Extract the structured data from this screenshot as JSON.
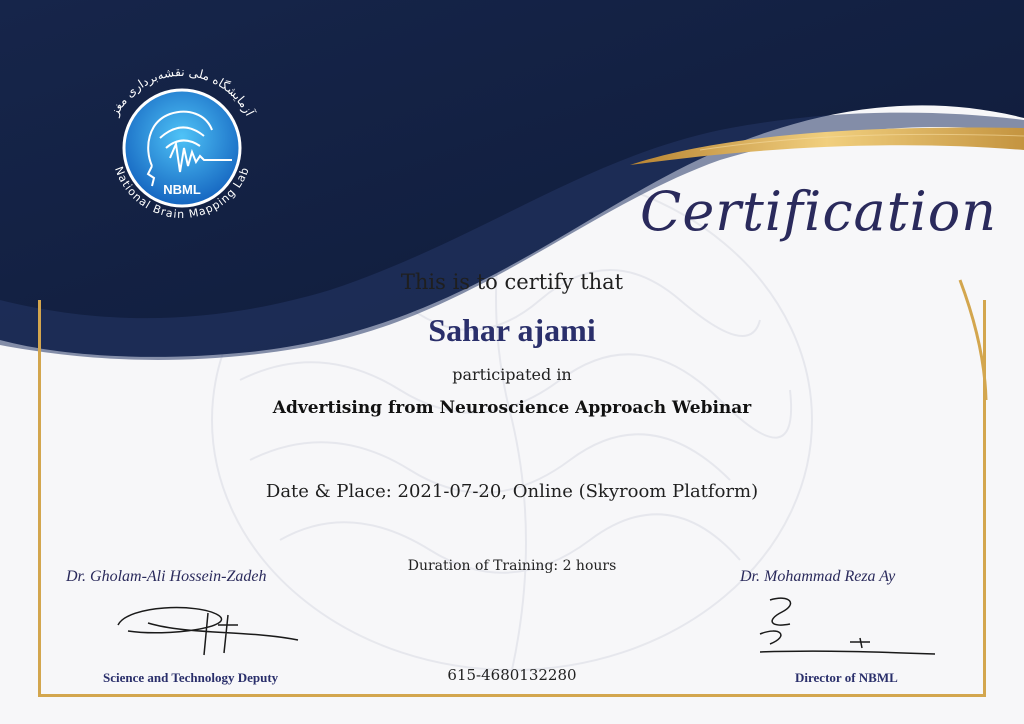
{
  "logo": {
    "text_fa": "آزمایشگاه ملی نقشه‌برداری مغز",
    "text_en": "National Brain Mapping Lab",
    "abbr": "NBML"
  },
  "title": "Certification",
  "intro": "This is to certify that",
  "recipient_name": "Sahar ajami",
  "participated_text": "participated in",
  "course_title": "Advertising from Neuroscience Approach Webinar",
  "date_place": "Date & Place: 2021-07-20, Online (Skyroom Platform)",
  "duration": "Duration of Training: 2 hours",
  "serial_number": "615-4680132280",
  "signatories": [
    {
      "name": "Dr. Gholam-Ali Hossein-Zadeh",
      "title": "Science and Technology Deputy"
    },
    {
      "name": "Dr. Mohammad Reza Ay",
      "title": "Director of NBML"
    }
  ],
  "colors": {
    "navy": "#16254a",
    "gold": "#d3a64e",
    "ink": "#2a2f6b",
    "logo_blue": "#1e8fd0"
  }
}
